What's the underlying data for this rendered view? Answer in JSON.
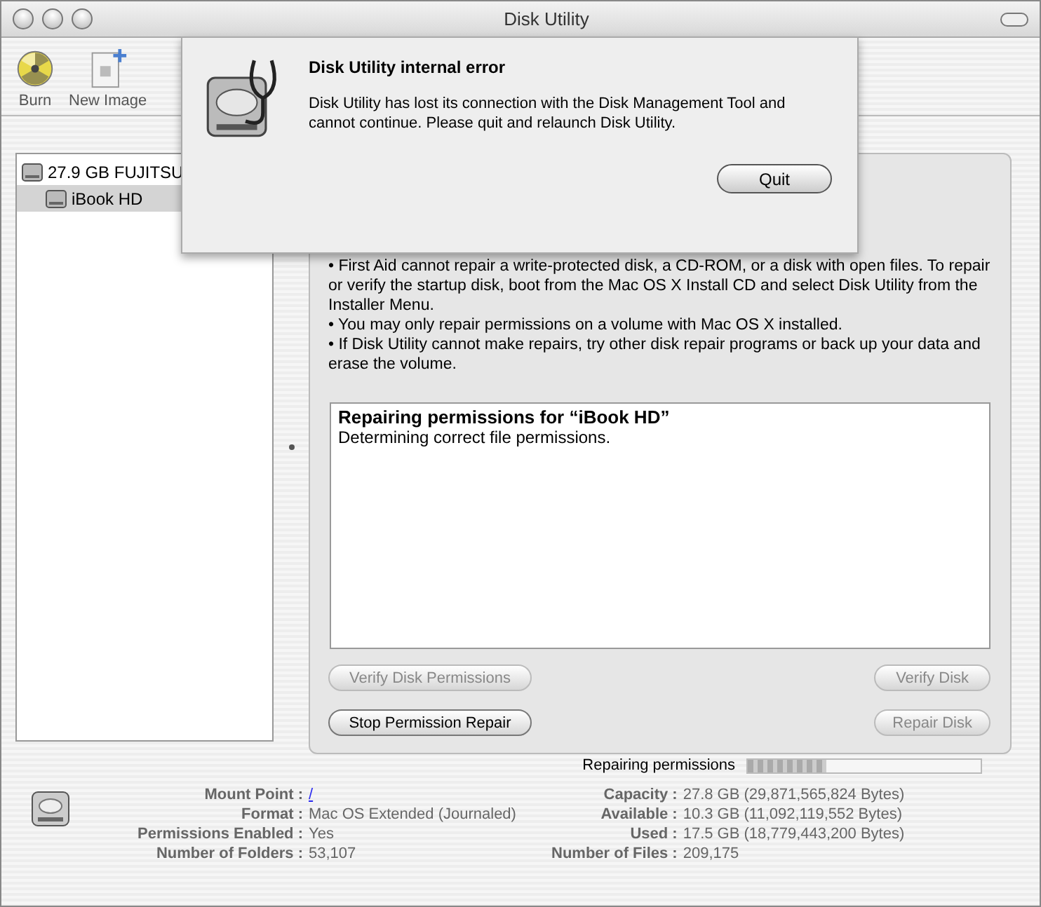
{
  "window": {
    "title": "Disk Utility"
  },
  "toolbar": [
    {
      "label": "Burn",
      "kind": "burn"
    },
    {
      "label": "New Image",
      "kind": "image"
    }
  ],
  "sidebar": {
    "items": [
      {
        "label": "27.9 GB FUJITSU",
        "selected": false,
        "children": [
          {
            "label": "iBook HD",
            "selected": true
          }
        ]
      }
    ]
  },
  "first_aid": {
    "bullets": [
      "• First Aid cannot repair a write-protected disk, a CD-ROM, or a disk with open files. To repair or verify the startup disk, boot from the Mac OS X Install CD and select Disk Utility from the Installer Menu.",
      "• You may only repair permissions on a volume with Mac OS X installed.",
      "• If Disk Utility cannot make repairs, try other disk repair programs or back up your data and erase the volume."
    ],
    "log": {
      "title": "Repairing permissions for “iBook HD”",
      "lines": [
        "Determining correct file permissions."
      ]
    },
    "buttons": [
      {
        "label": "Verify Disk Permissions",
        "disabled": true
      },
      {
        "label": "Verify Disk",
        "disabled": true
      },
      {
        "label": "Stop Permission Repair",
        "disabled": false
      },
      {
        "label": "Repair Disk",
        "disabled": true
      }
    ]
  },
  "progress": {
    "label": "Repairing permissions",
    "level": 0.34
  },
  "info": {
    "left": [
      {
        "label": "Mount Point :",
        "value": "/",
        "link": true
      },
      {
        "label": "Format :",
        "value": "Mac OS Extended (Journaled)",
        "link": false
      },
      {
        "label": "Permissions Enabled :",
        "value": "Yes",
        "link": false
      },
      {
        "label": "Number of Folders :",
        "value": "53,107",
        "link": false
      }
    ],
    "right": [
      {
        "label": "Capacity :",
        "value": "27.8 GB (29,871,565,824 Bytes)",
        "link": false
      },
      {
        "label": "Available :",
        "value": "10.3 GB (11,092,119,552 Bytes)",
        "link": false
      },
      {
        "label": "Used :",
        "value": "17.5 GB (18,779,443,200 Bytes)",
        "link": false
      },
      {
        "label": "Number of Files :",
        "value": "209,175",
        "link": false
      }
    ]
  },
  "dialog": {
    "title": "Disk Utility internal error",
    "message": "Disk Utility has lost its connection with the Disk Management Tool and cannot continue. Please quit and relaunch Disk Utility.",
    "button": "Quit"
  }
}
